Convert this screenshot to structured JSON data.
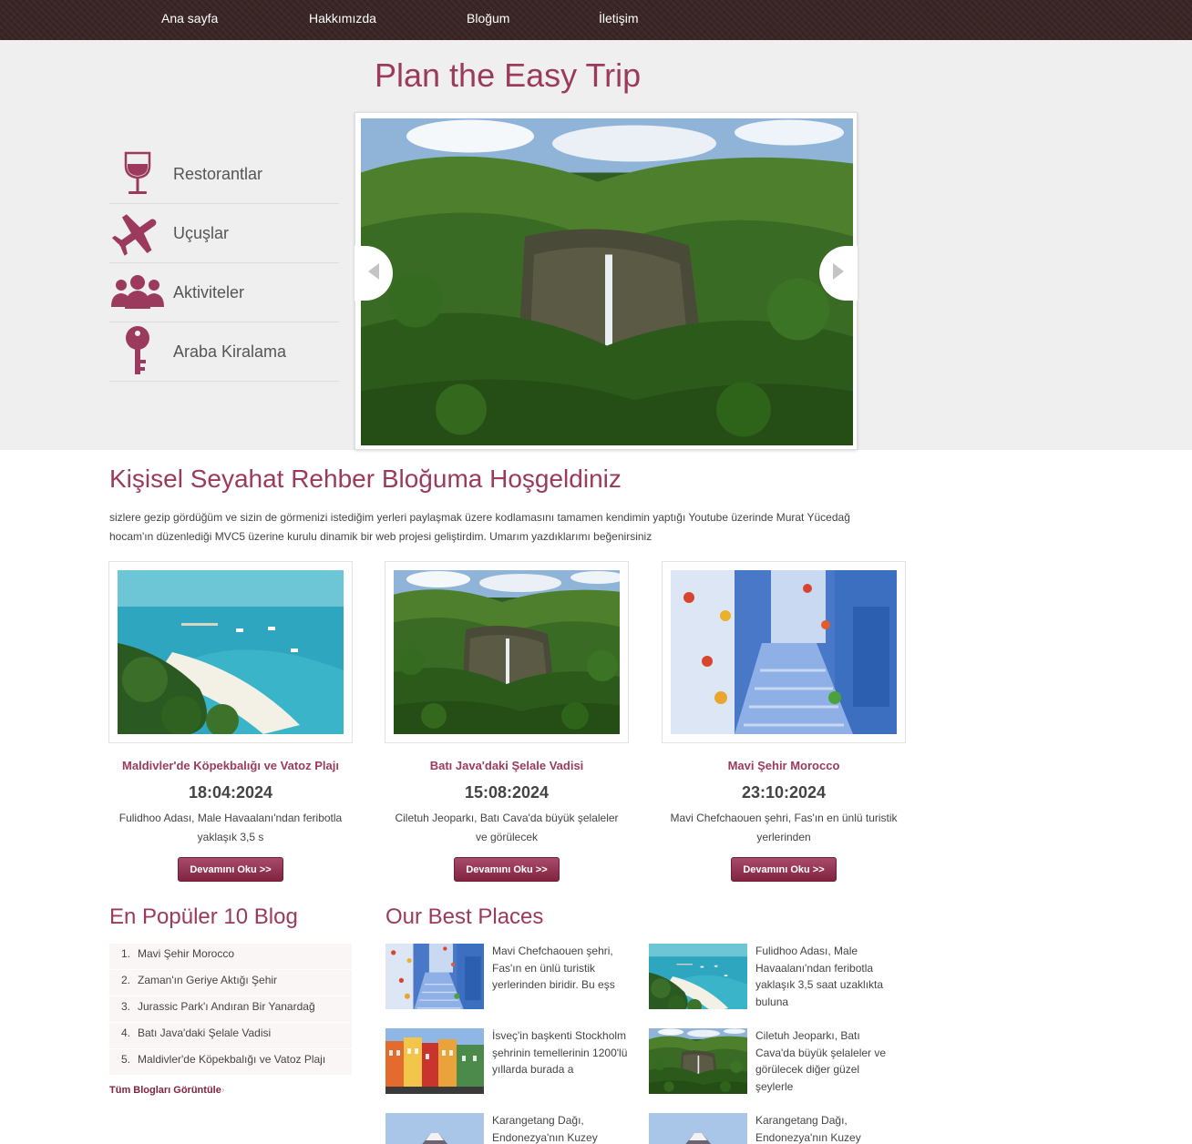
{
  "nav": {
    "items": [
      {
        "label": "Ana sayfa"
      },
      {
        "label": "Hakkımızda"
      },
      {
        "label": "Bloğum"
      },
      {
        "label": "İletişim"
      }
    ]
  },
  "hero": {
    "title": "Plan the Easy Trip",
    "categories": [
      {
        "label": "Restorantlar",
        "icon": "wine-glass-icon"
      },
      {
        "label": "Uçuşlar",
        "icon": "airplane-icon"
      },
      {
        "label": "Aktiviteler",
        "icon": "people-group-icon"
      },
      {
        "label": "Araba Kiralama",
        "icon": "key-icon"
      }
    ],
    "slider": {
      "image": "waterfall-valley-photo",
      "prev_icon": "arrow-left-icon",
      "next_icon": "arrow-right-icon"
    }
  },
  "welcome": {
    "title": "Kişisel Seyahat Rehber Bloğuma Hoşgeldiniz",
    "text": "sizlere gezip gördüğüm ve sizin de görmenizi istediğim yerleri paylaşmak üzere kodlamasını tamamen kendimin yaptığı Youtube üzerinde Murat Yücedağ hocam'ın düzenlediği MVC5 üzerine kurulu dinamik bir web projesi geliştirdim. Umarım yazdıklarımı beğenirsiniz"
  },
  "cards": [
    {
      "title": "Maldivler'de Köpekbalığı ve Vatoz Plajı",
      "date": "18:04:2024",
      "desc": "Fulidhoo Adası, Male Havaalanı'ndan feribotla yaklaşık 3,5 s",
      "button": "Devamını Oku >>",
      "image": "maldives-beach-photo"
    },
    {
      "title": "Batı Java'daki Şelale Vadisi",
      "date": "15:08:2024",
      "desc": "Ciletuh Jeoparkı, Batı Cava'da büyük şelaleler ve görülecek",
      "button": "Devamını Oku >>",
      "image": "waterfall-valley-photo"
    },
    {
      "title": "Mavi Şehir Morocco",
      "date": "23:10:2024",
      "desc": "Mavi Chefchaouen şehri, Fas'ın en ünlü turistik yerlerinden",
      "button": "Devamını Oku >>",
      "image": "blue-city-photo"
    }
  ],
  "popular": {
    "title": "En Popüler 10 Blog",
    "items": [
      {
        "num": "1.",
        "label": "Mavi Şehir Morocco"
      },
      {
        "num": "2.",
        "label": "Zaman'ın Geriye Aktığı Şehir"
      },
      {
        "num": "3.",
        "label": "Jurassic Park'ı Andıran Bir Yanardağ"
      },
      {
        "num": "4.",
        "label": "Batı Java'daki Şelale Vadisi"
      },
      {
        "num": "5.",
        "label": "Maldivler'de Köpekbalığı ve Vatoz Plajı"
      }
    ],
    "all_link": "Tüm Blogları Görüntüle",
    "all_chev": "›"
  },
  "best": {
    "title": "Our Best Places",
    "items": [
      {
        "text": "Mavi Chefchaouen şehri, Fas'ın en ünlü turistik yerlerinden biridir. Bu eşs",
        "image": "blue-city-photo"
      },
      {
        "text": "Fulidhoo Adası, Male Havaalanı'ndan feribotla yaklaşık 3,5 saat uzaklıkta buluna",
        "image": "maldives-beach-photo"
      },
      {
        "text": "İsveç'in başkenti Stockholm şehrinin temellerinin 1200'lü yıllarda burada a",
        "image": "stockholm-houses-photo"
      },
      {
        "text": "Ciletuh Jeoparkı, Batı Cava'da büyük şelaleler ve görülecek diğer güzel şeylerle",
        "image": "waterfall-valley-photo"
      },
      {
        "text": "Karangetang Dağı, Endonezya'nın Kuzey",
        "image": "volcano-photo"
      },
      {
        "text": "Karangetang Dağı, Endonezya'nın Kuzey",
        "image": "volcano-photo"
      }
    ]
  },
  "colors": {
    "accent": "#9b3a5c",
    "nav_bg": "#3a2525",
    "hero_bg": "#efefef",
    "button": "#8f3553"
  }
}
